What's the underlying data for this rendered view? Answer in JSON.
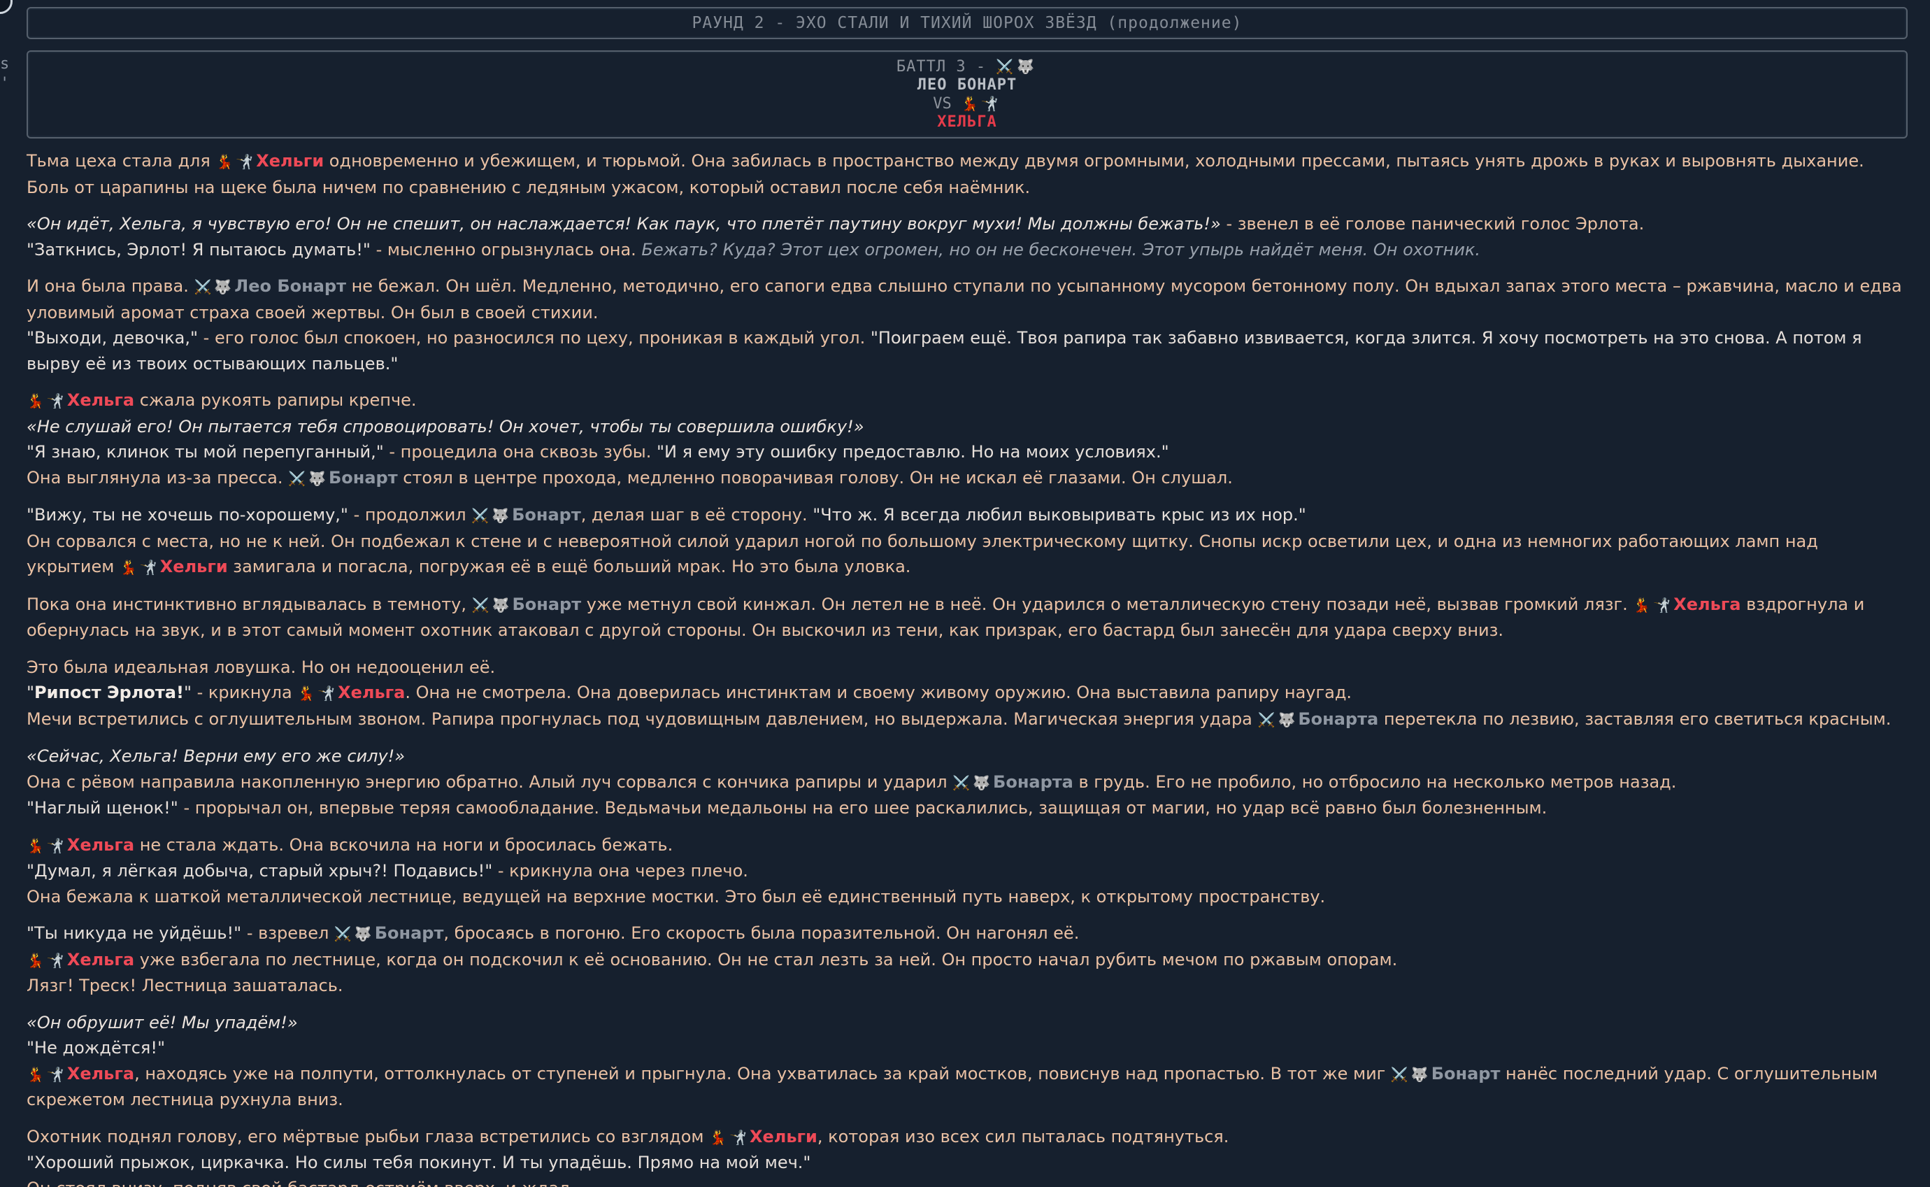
{
  "edge": {
    "left_text": "s\n't"
  },
  "round_header": "РАУНД 2 - ЭХО СТАЛИ И ТИХИЙ ШОРОХ ЗВЁЗД (продолжение)",
  "battle": {
    "line1": "БАТТЛ 3 -",
    "fighter1": "ЛЕО БОНАРТ",
    "vs": "VS",
    "fighter2": "ХЕЛЬГА"
  },
  "icons": {
    "dancer": "💃",
    "fencer": "🤺",
    "swords": "⚔️",
    "wolf": "🐺"
  },
  "names": {
    "helga": "Хельга",
    "helgi": "Хельги",
    "leo_bonart": "Лео Бонарт",
    "bonart": "Бонарт",
    "bonarta": "Бонарта"
  },
  "story": {
    "p1": {
      "a": "Тьма цеха стала для ",
      "b": " одновременно и убежищем, и тюрьмой. Она забилась в пространство между двумя огромными, холодными прессами, пытаясь унять дрожь в руках и выровнять дыхание. Боль от царапины на щеке была ничем по сравнению с ледяным ужасом, который оставил после себя наёмник."
    },
    "p2": {
      "l1_thought": "«Он идёт, Хельга, я чувствую его! Он не спешит, он наслаждается! Как паук, что плетёт паутину вокруг мухи! Мы должны бежать!»",
      "l1_rest": " - звенел в её голове панический голос Эрлота.",
      "l2_speech": "\"Заткнись, Эрлот! Я пытаюсь думать!\"",
      "l2_mid": " - мысленно огрызнулась она. ",
      "l2_italic": "Бежать? Куда? Этот цех огромен, но он не бесконечен. Этот упырь найдёт меня. Он охотник."
    },
    "p3": {
      "a": "И она была права. ",
      "b": " не бежал. Он шёл. Медленно, методично, его сапоги едва слышно ступали по усыпанному мусором бетонному полу. Он вдыхал запах этого места – ржавчина, масло и едва уловимый аромат страха своей жертвы. Он был в своей стихии.",
      "c_speech": "\"Выходи, девочка,\"",
      "c_rest": " - его голос был спокоен, но разносился по цеху, проникая в каждый угол. ",
      "c_speech2": "\"Поиграем ещё. Твоя рапира так забавно извивается, когда злится. Я хочу посмотреть на это снова. А потом я вырву её из твоих остывающих пальцев.\""
    },
    "p4": {
      "a": " сжала рукоять рапиры крепче.",
      "thought": "«Не слушай его! Он пытается тебя спровоцировать! Он хочет, чтобы ты совершила ошибку!»",
      "speech1": "\"Я знаю, клинок ты мой перепуганный,\"",
      "mid": " - процедила она сквозь зубы. ",
      "speech2": "\"И я ему эту ошибку предоставлю. Но на моих условиях.\"",
      "d": "Она выглянула из-за пресса. ",
      "e": " стоял в центре прохода, медленно поворачивая голову. Он не искал её глазами. Он слушал."
    },
    "p5": {
      "speech1": "\"Вижу, ты не хочешь по-хорошему,\"",
      "a": " - продолжил ",
      "b": ", делая шаг в её сторону. ",
      "speech2": "\"Что ж. Я всегда любил выковыривать крыс из их нор.\"",
      "c": "Он сорвался с места, но не к ней. Он подбежал к стене и с невероятной силой ударил ногой по большому электрическому щитку. Снопы искр осветили цех, и одна из немногих работающих ламп над укрытием ",
      "d": " замигала и погасла, погружая её в ещё больший мрак. Но это была уловка."
    },
    "p6": {
      "a": "Пока она инстинктивно вглядывалась в темноту, ",
      "b": " уже метнул свой кинжал. Он летел не в неё. Он ударился о металлическую стену позади неё, вызвав громкий лязг. ",
      "c": " вздрогнула и обернулась на звук, и в этот самый момент охотник атаковал с другой стороны. Он выскочил из тени, как призрак, его бастард был занесён для удара сверху вниз."
    },
    "p7": {
      "a": "Это была идеальная ловушка. Но он недооценил её.",
      "q_open": "\"",
      "bold": "Рипост Эрлота!",
      "q_close": "\"",
      "b": " - крикнула ",
      "c": ". Она не смотрела. Она доверилась инстинктам и своему живому оружию. Она выставила рапиру наугад.",
      "d": "Мечи встретились с оглушительным звоном. Рапира прогнулась под чудовищным давлением, но выдержала. Магическая энергия удара ",
      "e": " перетекла по лезвию, заставляя его светиться красным."
    },
    "p8": {
      "thought": "«Сейчас, Хельга! Верни ему его же силу!»",
      "a": "Она с рёвом направила накопленную энергию обратно. Алый луч сорвался с кончика рапиры и ударил ",
      "b": " в грудь. Его не пробило, но отбросило на несколько метров назад.",
      "speech": "\"Наглый щенок!\"",
      "c": " - прорычал он, впервые теряя самообладание. Ведьмачьи медальоны на его шее раскалились, защищая от магии, но удар всё равно был болезненным."
    },
    "p9": {
      "a": " не стала ждать. Она вскочила на ноги и бросилась бежать.",
      "speech": "\"Думал, я лёгкая добыча, старый хрыч?! Подавись!\"",
      "b": " - крикнула она через плечо.",
      "c": "Она бежала к шаткой металлической лестнице, ведущей на верхние мостки. Это был её единственный путь наверх, к открытому пространству."
    },
    "p10": {
      "speech": "\"Ты никуда не уйдёшь!\"",
      "a": " - взревел ",
      "b": ", бросаясь в погоню. Его скорость была поразительной. Он нагонял её.",
      "c": " уже взбегала по лестнице, когда он подскочил к её основанию. Он не стал лезть за ней. Он просто начал рубить мечом по ржавым опорам.",
      "d": "Лязг! Треск! Лестница зашаталась."
    },
    "p11": {
      "thought": "«Он обрушит её! Мы упадём!»",
      "speech": "\"Не дождётся!\"",
      "a": ", находясь уже на полпути, оттолкнулась от ступеней и прыгнула. Она ухватилась за край мостков, повиснув над пропастью. В тот же миг ",
      "b": " нанёс последний удар. С оглушительным скрежетом лестница рухнула вниз."
    },
    "p12": {
      "a": "Охотник поднял голову, его мёртвые рыбьи глаза встретились со взглядом ",
      "b": ", которая изо всех сил пыталась подтянуться.",
      "speech": "\"Хороший прыжок, циркачка. Но силы тебя покинут. И ты упадёшь. Прямо на мой меч.\"",
      "c": "Он стоял внизу, подняв свой бастард остриём вверх, и ждал."
    }
  }
}
